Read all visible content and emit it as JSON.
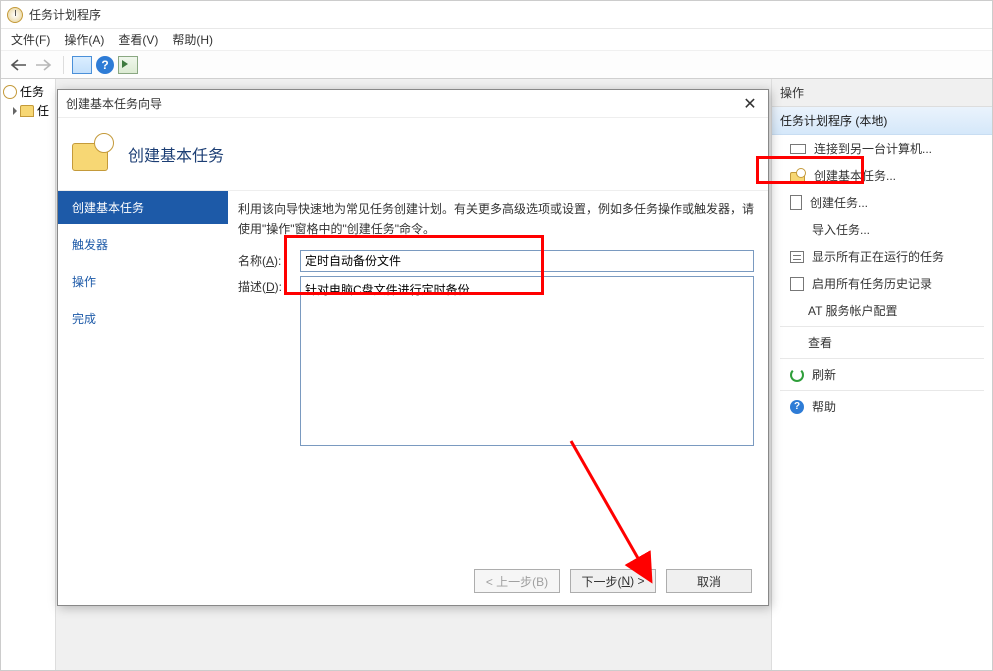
{
  "window": {
    "title": "任务计划程序"
  },
  "menubar": {
    "file": "文件(F)",
    "action": "操作(A)",
    "view": "查看(V)",
    "help": "帮助(H)"
  },
  "toolbar": {
    "back": "←",
    "forward": "→",
    "help_glyph": "?"
  },
  "tree": {
    "root_label": "任务",
    "child_prefix": "任"
  },
  "actions": {
    "header": "操作",
    "subheader": "任务计划程序 (本地)",
    "connect": "连接到另一台计算机...",
    "create_basic": "创建基本任务...",
    "create_task": "创建任务...",
    "import_task": "导入任务...",
    "show_running": "显示所有正在运行的任务",
    "enable_history": "启用所有任务历史记录",
    "at_service": "AT 服务帐户配置",
    "view": "查看",
    "refresh": "刷新",
    "help": "帮助"
  },
  "wizard": {
    "dialog_title": "创建基本任务向导",
    "close_glyph": "✕",
    "heading": "创建基本任务",
    "steps": {
      "s1": "创建基本任务",
      "s2": "触发器",
      "s3": "操作",
      "s4": "完成"
    },
    "intro": "利用该向导快速地为常见任务创建计划。有关更多高级选项或设置，例如多任务操作或触发器，请使用\"操作\"窗格中的\"创建任务\"命令。",
    "labels": {
      "name_pre": "名称(",
      "name_u": "A",
      "name_post": "):",
      "desc_pre": "描述(",
      "desc_u": "D",
      "desc_post": "):"
    },
    "name_value": "定时自动备份文件",
    "desc_value": "针对电脑C盘文件进行定时备份",
    "buttons": {
      "back": "< 上一步(B)",
      "next_pre": "下一步(",
      "next_u": "N",
      "next_post": ") >",
      "cancel": "取消"
    }
  }
}
